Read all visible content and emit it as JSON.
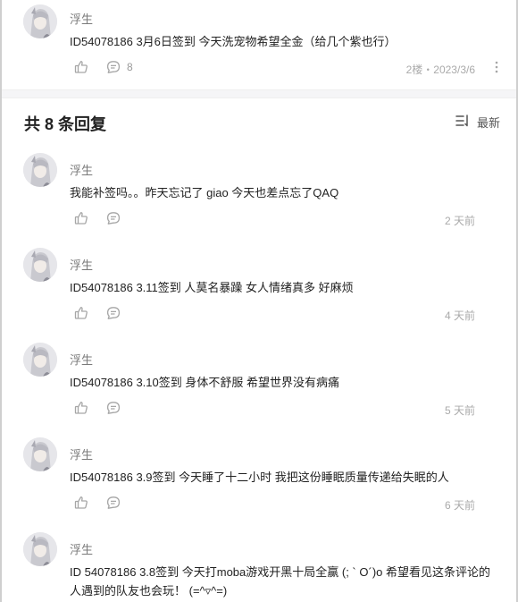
{
  "top_post": {
    "username": "浮生",
    "content": "ID54078186 3月6日签到 今天洗宠物希望全金（给几个紫也行）",
    "comment_count": "8",
    "floor_date": "2楼・2023/3/6"
  },
  "replies_header": {
    "title": "共 8 条回复",
    "sort_label": "最新"
  },
  "replies": [
    {
      "username": "浮生",
      "content": "我能补签吗。。昨天忘记了 giao 今天也差点忘了QAQ",
      "time": "2 天前"
    },
    {
      "username": "浮生",
      "content": "ID54078186 3.11签到 人莫名暴躁 女人情绪真多 好麻烦",
      "time": "4 天前"
    },
    {
      "username": "浮生",
      "content": "ID54078186 3.10签到 身体不舒服 希望世界没有病痛",
      "time": "5 天前"
    },
    {
      "username": "浮生",
      "content": "ID54078186 3.9签到 今天睡了十二小时 我把这份睡眠质量传递给失眠的人",
      "time": "6 天前"
    },
    {
      "username": "浮生",
      "content": "ID 54078186 3.8签到 今天打moba游戏开黑十局全赢 (; ` O´)o 希望看见这条评论的人遇到的队友也会玩！ (=^▿^=)",
      "time": ""
    }
  ],
  "icons": {
    "like": "thumbs-up-icon",
    "comment": "comment-bubble-icon",
    "more": "more-vertical-icon",
    "sort": "sort-lines-icon"
  },
  "colors": {
    "icon": "#a6a6a6",
    "meta_text": "#aaaaaa",
    "username": "#7a7a7a",
    "content": "#222222"
  }
}
